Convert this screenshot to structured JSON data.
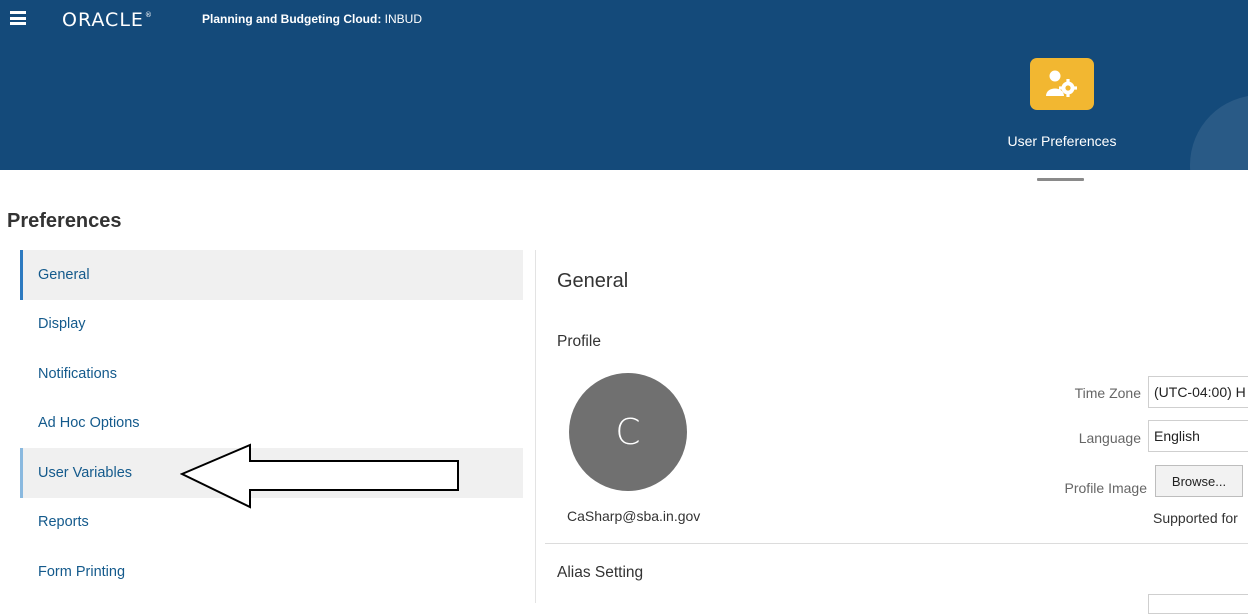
{
  "header": {
    "logo": "ORACLE",
    "app_name_bold": "Planning and Budgeting Cloud:",
    "app_instance": "INBUD",
    "module_label": "User Preferences"
  },
  "page": {
    "title": "Preferences"
  },
  "nav": {
    "items": [
      {
        "label": "General",
        "state": "selected"
      },
      {
        "label": "Display",
        "state": ""
      },
      {
        "label": "Notifications",
        "state": ""
      },
      {
        "label": "Ad Hoc Options",
        "state": ""
      },
      {
        "label": "User Variables",
        "state": "highlight"
      },
      {
        "label": "Reports",
        "state": ""
      },
      {
        "label": "Form Printing",
        "state": ""
      }
    ]
  },
  "content": {
    "title": "General",
    "profile_section": "Profile",
    "avatar_initial": "C",
    "email": "CaSharp@sba.in.gov",
    "time_zone_label": "Time Zone",
    "time_zone_value": "(UTC-04:00) H",
    "language_label": "Language",
    "language_value": "English",
    "profile_image_label": "Profile Image",
    "browse_label": "Browse...",
    "supported_text": "Supported for",
    "alias_section": "Alias Setting"
  },
  "colors": {
    "header_bg": "#144a7a",
    "tile_bg": "#f2b731",
    "nav_link": "#145a8c",
    "nav_selected_border": "#2d7ac0"
  }
}
